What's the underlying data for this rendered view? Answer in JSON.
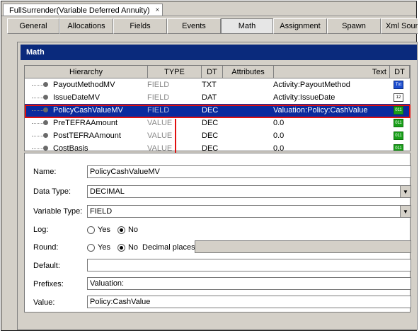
{
  "document_tab": {
    "title": "FullSurrender(Variable Deferred Annuity)",
    "close": "×"
  },
  "tabs": [
    {
      "label": "General"
    },
    {
      "label": "Allocations"
    },
    {
      "label": "Fields"
    },
    {
      "label": "Events"
    },
    {
      "label": "Math"
    },
    {
      "label": "Assignment"
    },
    {
      "label": "Spawn"
    },
    {
      "label": "Xml Source"
    }
  ],
  "active_tab": "Math",
  "panel": {
    "title": "Math"
  },
  "grid": {
    "columns": [
      "Hierarchy",
      "TYPE",
      "DT",
      "Attributes",
      "Text",
      "DT"
    ],
    "rows": [
      {
        "name": "PayoutMethodMV",
        "type": "FIELD",
        "dt": "TXT",
        "attributes": "",
        "text": "Activity:PayoutMethod",
        "badge": "Txt",
        "badge_kind": "txt"
      },
      {
        "name": "IssueDateMV",
        "type": "FIELD",
        "dt": "DAT",
        "attributes": "",
        "text": "Activity:IssueDate",
        "badge": "12",
        "badge_kind": "dat"
      },
      {
        "name": "PolicyCashValueMV",
        "type": "FIELD",
        "dt": "DEC",
        "attributes": "",
        "text": "Valuation:Policy:CashValue",
        "badge": "011",
        "badge_kind": "dec"
      },
      {
        "name": "PreTEFRAAmount",
        "type": "VALUE",
        "dt": "DEC",
        "attributes": "",
        "text": "0.0",
        "badge": "011",
        "badge_kind": "dec"
      },
      {
        "name": "PostTEFRAAmount",
        "type": "VALUE",
        "dt": "DEC",
        "attributes": "",
        "text": "0.0",
        "badge": "011",
        "badge_kind": "dec"
      },
      {
        "name": "CostBasis",
        "type": "VALUE",
        "dt": "DEC",
        "attributes": "",
        "text": "0.0",
        "badge": "011",
        "badge_kind": "dec"
      }
    ],
    "selected_index": 2
  },
  "form": {
    "name_label": "Name:",
    "name_value": "PolicyCashValueMV",
    "data_type_label": "Data Type:",
    "data_type_value": "DECIMAL",
    "variable_type_label": "Variable Type:",
    "variable_type_value": "FIELD",
    "log_label": "Log:",
    "round_label": "Round:",
    "yes_label": "Yes",
    "no_label": "No",
    "decimal_places_label": "Decimal places:",
    "default_label": "Default:",
    "default_value": "",
    "prefixes_label": "Prefixes:",
    "prefixes_value": "Valuation:",
    "value_label": "Value:",
    "value_value": "Policy:CashValue",
    "log_selected": "No",
    "round_selected": "No"
  }
}
